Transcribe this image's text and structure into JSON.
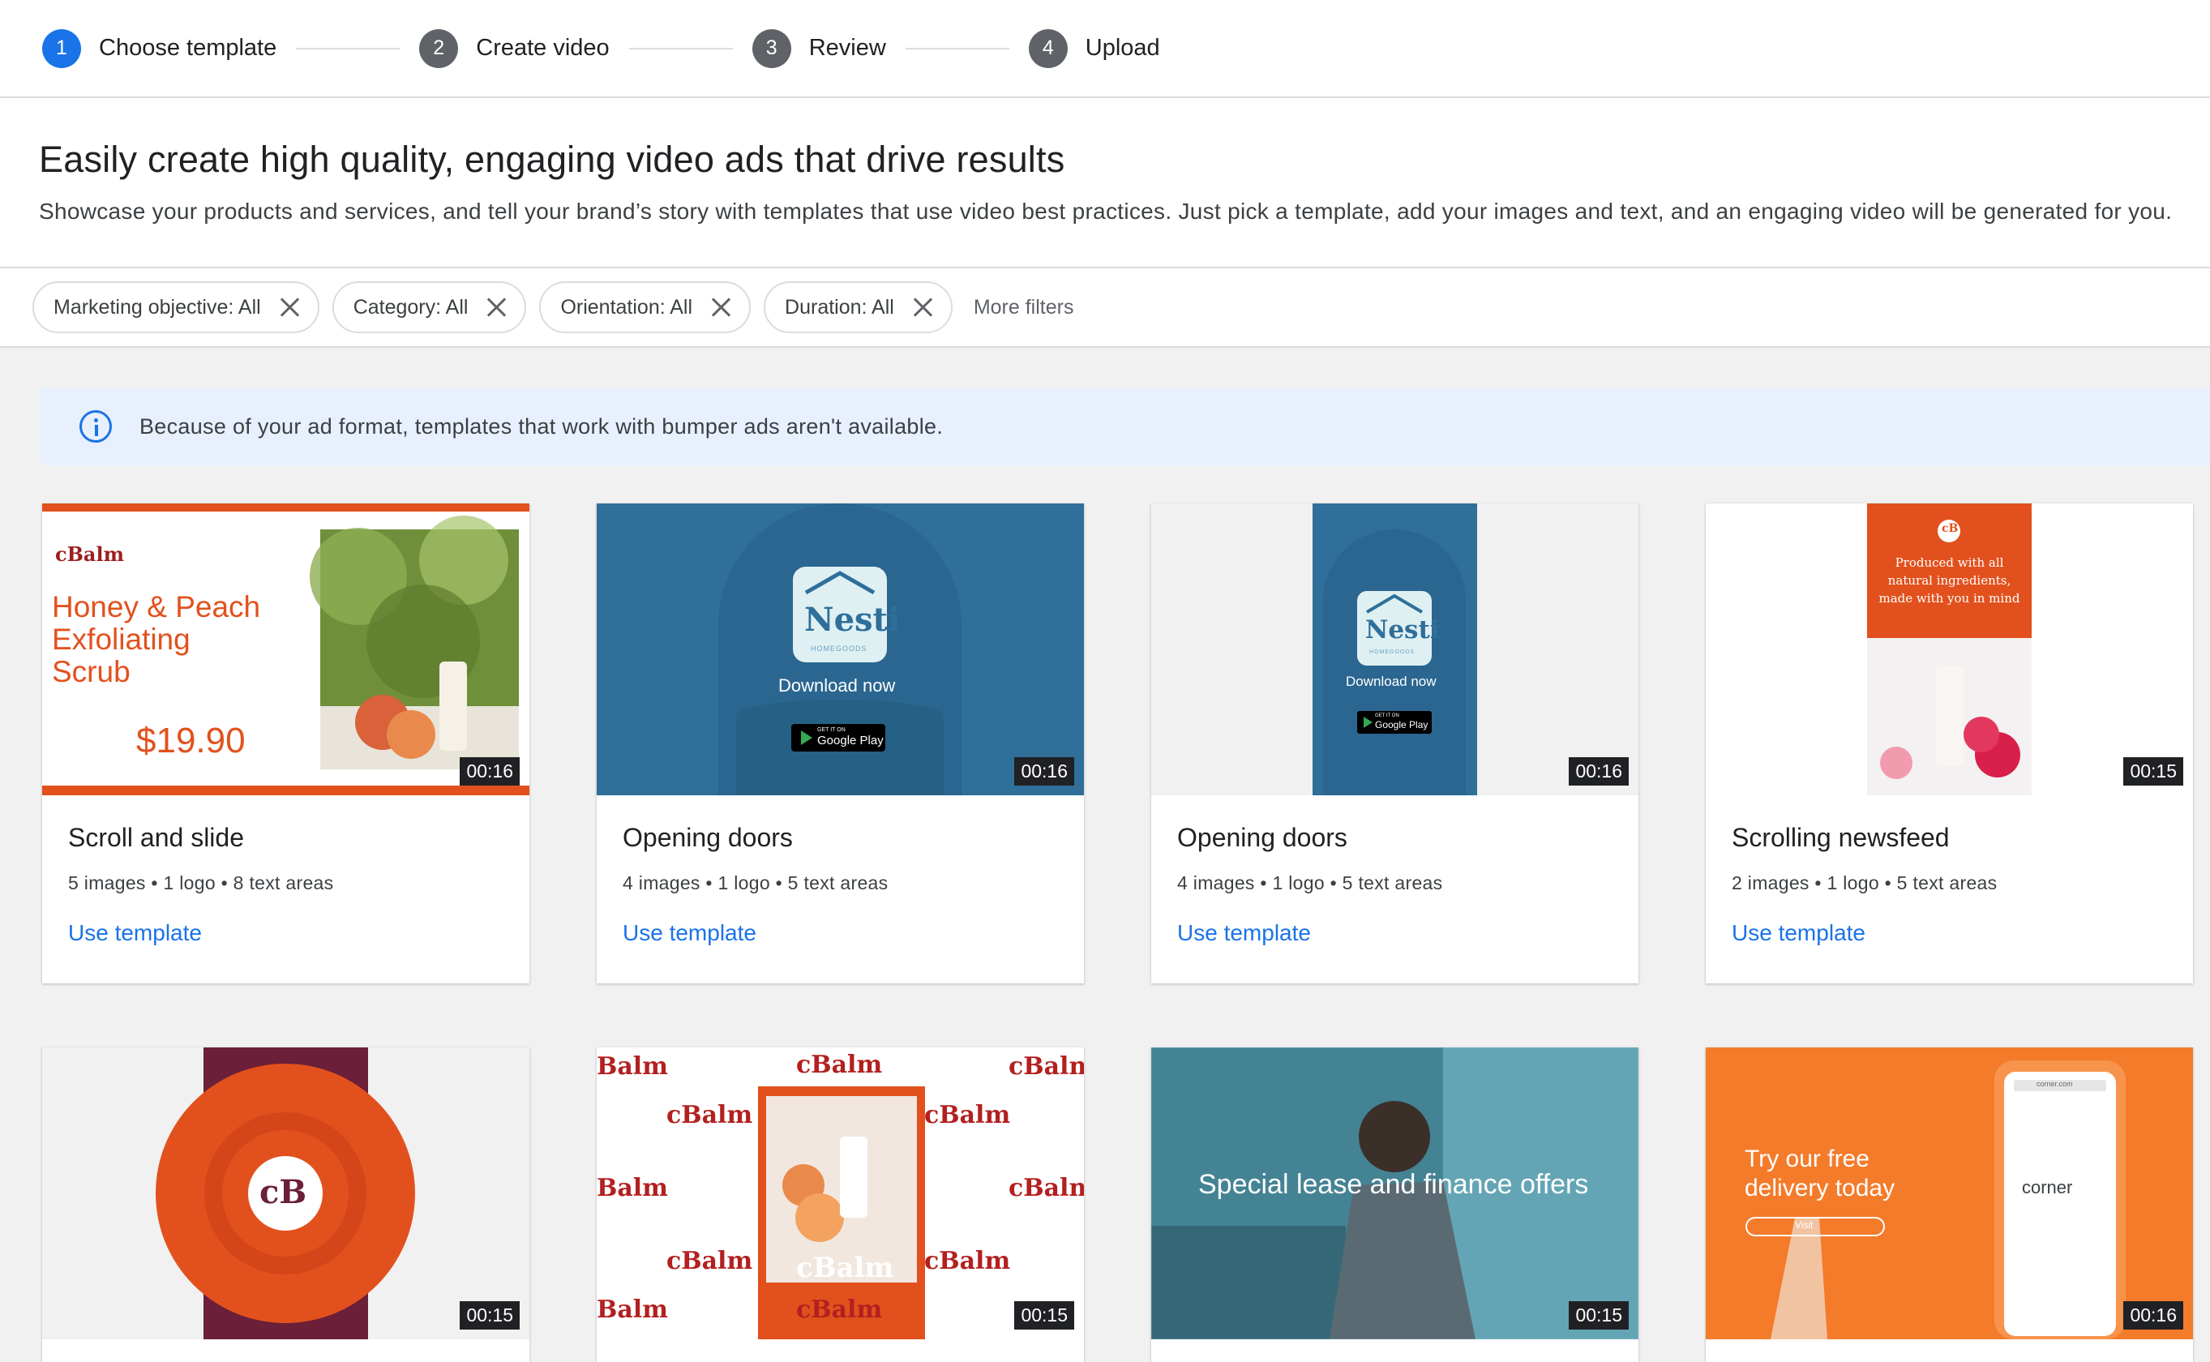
{
  "stepper": [
    {
      "num": "1",
      "label": "Choose template"
    },
    {
      "num": "2",
      "label": "Create video"
    },
    {
      "num": "3",
      "label": "Review"
    },
    {
      "num": "4",
      "label": "Upload"
    }
  ],
  "hero": {
    "title": "Easily create high quality, engaging video ads that drive results",
    "subtitle": "Showcase your products and services, and tell your brand’s story with templates that use video best practices. Just pick a template, add your images and text, and an engaging video will be generated for you."
  },
  "filters": {
    "chips": [
      "Marketing objective: All",
      "Category: All",
      "Orientation: All",
      "Duration: All"
    ],
    "more": "More filters"
  },
  "banner": {
    "text": "Because of your ad format, templates that work with bumper ads aren't available."
  },
  "cards": [
    {
      "title": "Scroll and slide",
      "meta": "5 images • 1 logo • 8 text areas",
      "link": "Use template",
      "duration": "00:16",
      "thumb": {
        "brand": "cBalm",
        "headline_1": "Honey & Peach",
        "headline_2": "Exfoliating",
        "headline_3": "Scrub",
        "price": "$19.90"
      }
    },
    {
      "title": "Opening doors",
      "meta": "4 images • 1 logo • 5 text areas",
      "link": "Use template",
      "duration": "00:16",
      "thumb": {
        "logo": "Nesti",
        "logo_sub": "HOMEGOODS",
        "cta": "Download now",
        "store_small": "GET IT ON",
        "store": "Google Play"
      }
    },
    {
      "title": "Opening doors",
      "meta": "4 images • 1 logo • 5 text areas",
      "link": "Use template",
      "duration": "00:16",
      "thumb": {
        "logo": "Nesti",
        "logo_sub": "HOMEGOODS",
        "cta": "Download now",
        "store_small": "GET IT ON",
        "store": "Google Play"
      }
    },
    {
      "title": "Scrolling newsfeed",
      "meta": "2 images • 1 logo • 5 text areas",
      "link": "Use template",
      "duration": "00:15",
      "thumb": {
        "badge": "cB",
        "line_1": "Produced with all",
        "line_2": "natural ingredients,",
        "line_3": "made with you in mind"
      }
    }
  ],
  "cards_row2": [
    {
      "duration": "00:15",
      "thumb": {
        "badge": "cB"
      }
    },
    {
      "duration": "00:15",
      "thumb": {
        "brand": "cBalm"
      }
    },
    {
      "duration": "00:15",
      "thumb": {
        "headline": "Special lease and finance offers"
      }
    },
    {
      "duration": "00:16",
      "thumb": {
        "line_1": "Try our free",
        "line_2": "delivery today",
        "button": "Visit",
        "url": "corner.com",
        "brand": "corner"
      }
    }
  ],
  "colors": {
    "accent": "#1a73e8",
    "balm_orange": "#e2511d",
    "nesti_blue": "#2f6f9a",
    "corner_orange": "#f47b2a"
  }
}
